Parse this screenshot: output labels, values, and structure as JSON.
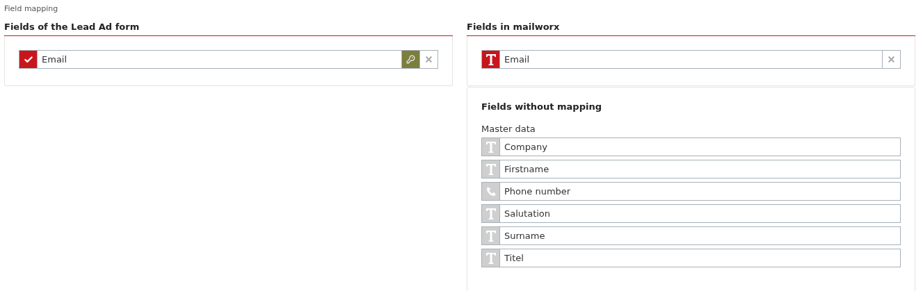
{
  "section_title": "Field mapping",
  "lead_form": {
    "heading": "Fields of the Lead Ad form",
    "fields": [
      {
        "label": "Email",
        "kind": "checked",
        "key": true
      }
    ]
  },
  "mailworx": {
    "heading": "Fields in mailworx",
    "fields": [
      {
        "label": "Email",
        "kind": "text"
      }
    ]
  },
  "unmapped": {
    "heading": "Fields without mapping",
    "group": "Master data",
    "fields": [
      {
        "label": "Company",
        "kind": "text"
      },
      {
        "label": "Firstname",
        "kind": "text"
      },
      {
        "label": "Phone number",
        "kind": "phone"
      },
      {
        "label": "Salutation",
        "kind": "text"
      },
      {
        "label": "Surname",
        "kind": "text"
      },
      {
        "label": "Titel",
        "kind": "text"
      }
    ]
  }
}
